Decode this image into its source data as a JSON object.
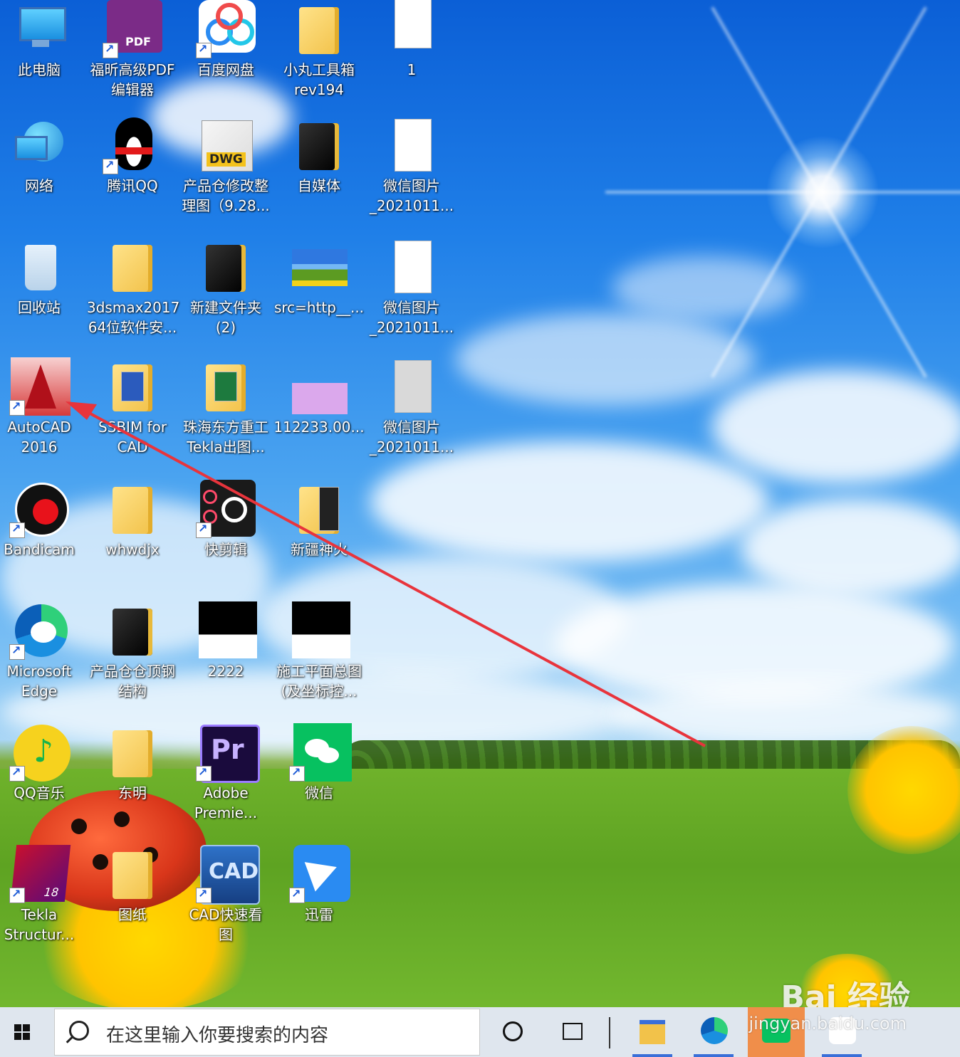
{
  "desktop": {
    "icons": [
      {
        "label": "此电脑"
      },
      {
        "label": "福昕高级PDF\n编辑器",
        "badge": "PDF"
      },
      {
        "label": "百度网盘"
      },
      {
        "label": "小丸工具箱\nrev194"
      },
      {
        "label": "1"
      },
      {
        "label": "网络"
      },
      {
        "label": "腾讯QQ"
      },
      {
        "label": "产品仓修改整\n理图（9.28...",
        "badge": "DWG"
      },
      {
        "label": "自媒体"
      },
      {
        "label": "微信图片\n_2021011..."
      },
      {
        "label": "回收站"
      },
      {
        "label": "3dsmax2017\n64位软件安..."
      },
      {
        "label": "新建文件夹\n(2)"
      },
      {
        "label": "src=http__..."
      },
      {
        "label": "微信图片\n_2021011..."
      },
      {
        "label": "AutoCAD\n2016"
      },
      {
        "label": "SSBIM for\nCAD"
      },
      {
        "label": "珠海东方重工\nTekla出图..."
      },
      {
        "label": "112233.00..."
      },
      {
        "label": "微信图片\n_2021011..."
      },
      {
        "label": "Bandicam"
      },
      {
        "label": "whwdjx"
      },
      {
        "label": "快剪辑"
      },
      {
        "label": "新疆神火"
      },
      {
        "label": "Microsoft\nEdge"
      },
      {
        "label": "产品仓仓顶钢\n结构"
      },
      {
        "label": "2222"
      },
      {
        "label": "施工平面总图\n(及坐标控..."
      },
      {
        "label": "QQ音乐"
      },
      {
        "label": "东明"
      },
      {
        "label": "Adobe\nPremie...",
        "badge": "Pr"
      },
      {
        "label": "微信"
      },
      {
        "label": "Tekla\nStructur...",
        "badge": "18"
      },
      {
        "label": "图纸"
      },
      {
        "label": "CAD快速看\n图",
        "badge": "CAD"
      },
      {
        "label": "迅雷"
      }
    ]
  },
  "taskbar": {
    "search_placeholder": "在这里输入你要搜索的内容"
  },
  "watermark": {
    "brand": "Bai 经验",
    "url": "jingyan.baidu.com"
  },
  "colors": {
    "taskbar_bg": "#dfe6ee",
    "annotation_arrow": "#e8343c",
    "active_underline": "#3a6fd8"
  }
}
